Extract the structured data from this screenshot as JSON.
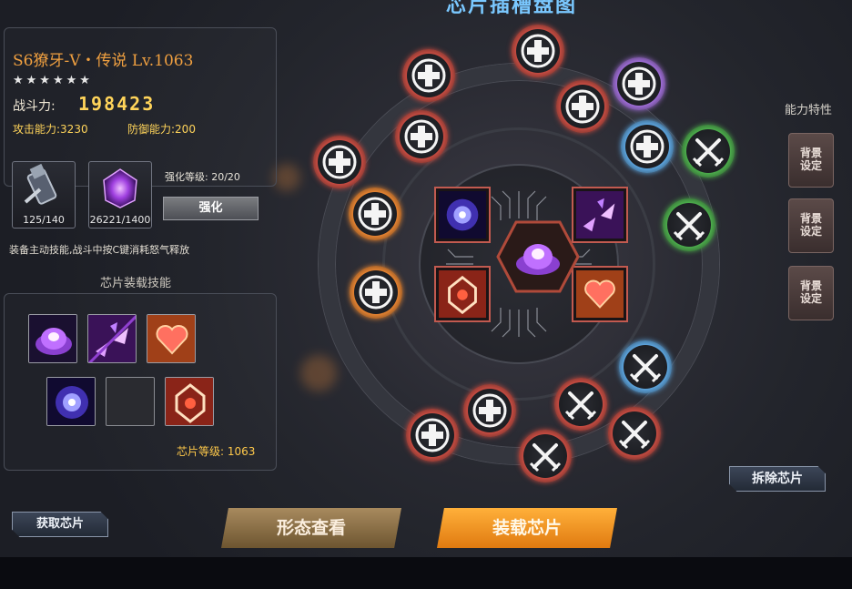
{
  "header": {
    "top_title": "芯片插槽盘图"
  },
  "character": {
    "name": "S6獠牙-Ⅴ・传说 Lv.1063",
    "stars": "★★★★★★",
    "power_label": "战斗力:",
    "power_value": "198423",
    "attack_label": "攻击能力:3230",
    "defense_label": "防御能力:200"
  },
  "equipment": {
    "item1_count": "125/140",
    "item2_count": "26221/1400",
    "enhance_level": "强化等级: 20/20",
    "enhance_button": "强化",
    "description": "装备主动技能,战斗中按C键消耗怒气释放"
  },
  "skills_section": {
    "title": "芯片装载技能",
    "chip_level": "芯片等级: 1063"
  },
  "right_panel": {
    "label": "能力特性",
    "buttons": [
      "背景\n设定",
      "背景\n设定",
      "背景\n设定"
    ]
  },
  "actions": {
    "remove_chip": "拆除芯片",
    "get_chip": "获取芯片",
    "view_form": "形态查看",
    "equip_chip": "装载芯片"
  },
  "colors": {
    "accent_orange": "#f0a040",
    "gold": "#ffd45a",
    "equip_orange": "#ff9a20",
    "slot_red": "#c24a40",
    "slot_orange": "#e08030",
    "slot_purple": "#9a6ad0",
    "slot_blue": "#5aa0d8",
    "slot_green": "#4aa84a"
  },
  "slots": [
    {
      "type": "plus",
      "color": "red"
    },
    {
      "type": "plus",
      "color": "red"
    },
    {
      "type": "plus",
      "color": "purple"
    },
    {
      "type": "plus",
      "color": "red"
    },
    {
      "type": "plus",
      "color": "red"
    },
    {
      "type": "plus",
      "color": "blue"
    },
    {
      "type": "swords",
      "color": "green"
    },
    {
      "type": "plus",
      "color": "red"
    },
    {
      "type": "plus",
      "color": "orange"
    },
    {
      "type": "swords",
      "color": "green"
    },
    {
      "type": "plus",
      "color": "orange"
    },
    {
      "type": "swords",
      "color": "blue"
    },
    {
      "type": "plus",
      "color": "red"
    },
    {
      "type": "swords",
      "color": "red"
    },
    {
      "type": "plus",
      "color": "red"
    },
    {
      "type": "swords",
      "color": "red"
    },
    {
      "type": "swords",
      "color": "red"
    }
  ]
}
